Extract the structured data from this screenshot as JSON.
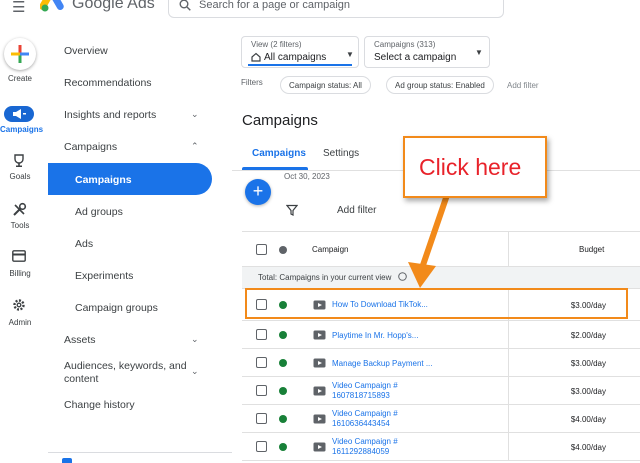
{
  "app": {
    "product_name": "Google Ads",
    "search_placeholder": "Search for a page or campaign"
  },
  "rail": {
    "create": "Create",
    "campaigns": "Campaigns",
    "goals": "Goals",
    "tools": "Tools",
    "billing": "Billing",
    "admin": "Admin"
  },
  "nav": {
    "overview": "Overview",
    "recommendations": "Recommendations",
    "insights": "Insights and reports",
    "campaigns": "Campaigns",
    "campaigns_sub": "Campaigns",
    "ad_groups": "Ad groups",
    "ads": "Ads",
    "experiments": "Experiments",
    "campaign_groups": "Campaign groups",
    "assets": "Assets",
    "audiences_line1": "Audiences, keywords, and",
    "audiences_line2": "content",
    "change_history": "Change history"
  },
  "view_selector": {
    "caption": "View (2 filters)",
    "value": "All campaigns"
  },
  "campaign_selector": {
    "caption": "Campaigns (313)",
    "value": "Select a campaign"
  },
  "filters": {
    "label": "Filters",
    "chips": [
      "Campaign status: All",
      "Ad group status: Enabled"
    ],
    "add_filter": "Add filter"
  },
  "page": {
    "title": "Campaigns",
    "tabs": [
      "Campaigns",
      "Settings"
    ],
    "date": "Oct 30, 2023",
    "add_filter": "Add filter"
  },
  "table": {
    "headers": {
      "campaign": "Campaign",
      "budget": "Budget"
    },
    "total_label": "Total: Campaigns in your current view",
    "rows": [
      {
        "name": "How To Download TikTok...",
        "budget": "$3.00/day"
      },
      {
        "name": "Playtime In Mr. Hopp's...",
        "budget": "$2.00/day"
      },
      {
        "name": "Manage Backup Payment ...",
        "budget": "$3.00/day"
      },
      {
        "name": "Video Campaign # 1607818715893",
        "name_l1": "Video Campaign #",
        "name_l2": "1607818715893",
        "budget": "$3.00/day"
      },
      {
        "name": "Video Campaign # 1610636443454",
        "name_l1": "Video Campaign #",
        "name_l2": "1610636443454",
        "budget": "$4.00/day"
      },
      {
        "name": "Video Campaign # 1611292884059",
        "name_l1": "Video Campaign #",
        "name_l2": "1611292884059",
        "budget": "$4.00/day"
      }
    ]
  },
  "annotation": {
    "callout_text": "Click here",
    "color": "#f28a1a",
    "text_color": "#e8222a"
  },
  "colors": {
    "accent": "#1a73e8",
    "status_enabled": "#188038"
  }
}
